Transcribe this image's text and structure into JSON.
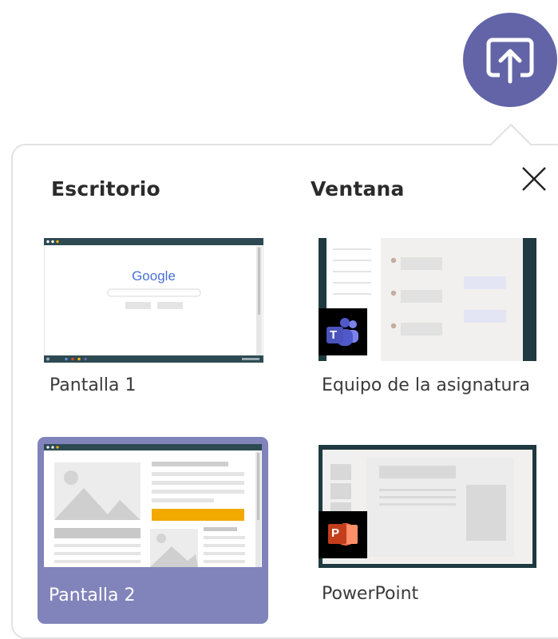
{
  "share": {
    "icon": "share-screen-icon",
    "accent": "#6264a7"
  },
  "panel": {
    "close_icon": "close-icon"
  },
  "columns": {
    "desktop": "Escritorio",
    "window": "Ventana"
  },
  "sources": [
    {
      "label": "Pantalla 1",
      "selected": false,
      "icon": "desktop-thumbnail-icon"
    },
    {
      "label": "Equipo de la asignatura",
      "selected": false,
      "icon": "teams-icon"
    },
    {
      "label": "Pantalla 2",
      "selected": true,
      "icon": "desktop-thumbnail-icon"
    },
    {
      "label": "PowerPoint",
      "selected": false,
      "icon": "powerpoint-icon"
    }
  ],
  "google_thumb": {
    "logo_text": "Google"
  },
  "teams_badge": {
    "letter": "T"
  },
  "ppt_badge": {
    "letter": "P"
  },
  "colors": {
    "selected_tile": "#8183bb",
    "teams_purple": "#6264a7",
    "ppt_orange": "#d24726",
    "dark_frame": "#1f3a40"
  }
}
